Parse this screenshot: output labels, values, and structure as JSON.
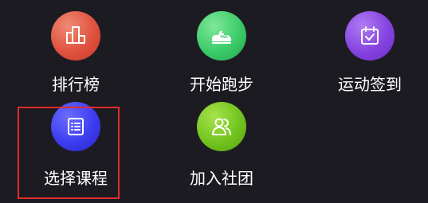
{
  "menu": {
    "items": [
      {
        "label": "排行榜",
        "icon": "leaderboard-icon",
        "color": "#e0533f"
      },
      {
        "label": "开始跑步",
        "icon": "running-shoe-icon",
        "color": "#3ccb69"
      },
      {
        "label": "运动签到",
        "icon": "calendar-check-icon",
        "color": "#8543e0"
      },
      {
        "label": "选择课程",
        "icon": "course-list-icon",
        "color": "#3d3df0"
      },
      {
        "label": "加入社团",
        "icon": "group-people-icon",
        "color": "#72c41f"
      }
    ]
  },
  "highlight": {
    "color": "#e02b2b",
    "target": "选择课程"
  },
  "background": "#1c1b22"
}
